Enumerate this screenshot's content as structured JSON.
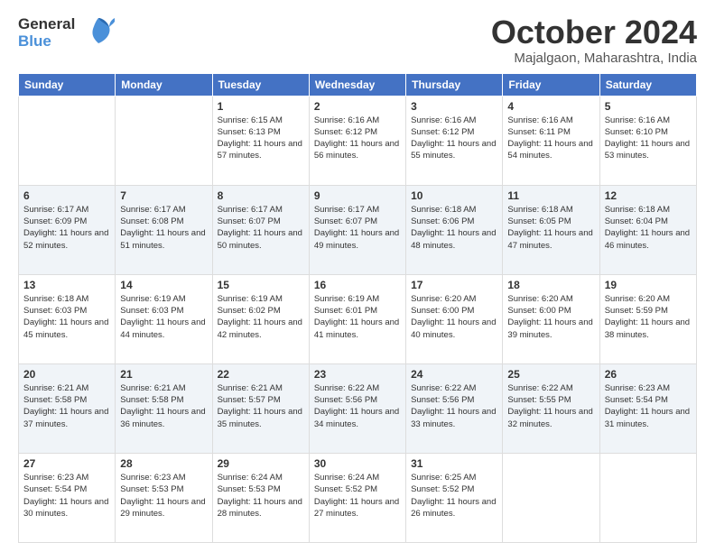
{
  "header": {
    "logo_line1": "General",
    "logo_line2": "Blue",
    "month": "October 2024",
    "location": "Majalgaon, Maharashtra, India"
  },
  "weekdays": [
    "Sunday",
    "Monday",
    "Tuesday",
    "Wednesday",
    "Thursday",
    "Friday",
    "Saturday"
  ],
  "weeks": [
    [
      {
        "day": "",
        "sunrise": "",
        "sunset": "",
        "daylight": ""
      },
      {
        "day": "",
        "sunrise": "",
        "sunset": "",
        "daylight": ""
      },
      {
        "day": "1",
        "sunrise": "Sunrise: 6:15 AM",
        "sunset": "Sunset: 6:13 PM",
        "daylight": "Daylight: 11 hours and 57 minutes."
      },
      {
        "day": "2",
        "sunrise": "Sunrise: 6:16 AM",
        "sunset": "Sunset: 6:12 PM",
        "daylight": "Daylight: 11 hours and 56 minutes."
      },
      {
        "day": "3",
        "sunrise": "Sunrise: 6:16 AM",
        "sunset": "Sunset: 6:12 PM",
        "daylight": "Daylight: 11 hours and 55 minutes."
      },
      {
        "day": "4",
        "sunrise": "Sunrise: 6:16 AM",
        "sunset": "Sunset: 6:11 PM",
        "daylight": "Daylight: 11 hours and 54 minutes."
      },
      {
        "day": "5",
        "sunrise": "Sunrise: 6:16 AM",
        "sunset": "Sunset: 6:10 PM",
        "daylight": "Daylight: 11 hours and 53 minutes."
      }
    ],
    [
      {
        "day": "6",
        "sunrise": "Sunrise: 6:17 AM",
        "sunset": "Sunset: 6:09 PM",
        "daylight": "Daylight: 11 hours and 52 minutes."
      },
      {
        "day": "7",
        "sunrise": "Sunrise: 6:17 AM",
        "sunset": "Sunset: 6:08 PM",
        "daylight": "Daylight: 11 hours and 51 minutes."
      },
      {
        "day": "8",
        "sunrise": "Sunrise: 6:17 AM",
        "sunset": "Sunset: 6:07 PM",
        "daylight": "Daylight: 11 hours and 50 minutes."
      },
      {
        "day": "9",
        "sunrise": "Sunrise: 6:17 AM",
        "sunset": "Sunset: 6:07 PM",
        "daylight": "Daylight: 11 hours and 49 minutes."
      },
      {
        "day": "10",
        "sunrise": "Sunrise: 6:18 AM",
        "sunset": "Sunset: 6:06 PM",
        "daylight": "Daylight: 11 hours and 48 minutes."
      },
      {
        "day": "11",
        "sunrise": "Sunrise: 6:18 AM",
        "sunset": "Sunset: 6:05 PM",
        "daylight": "Daylight: 11 hours and 47 minutes."
      },
      {
        "day": "12",
        "sunrise": "Sunrise: 6:18 AM",
        "sunset": "Sunset: 6:04 PM",
        "daylight": "Daylight: 11 hours and 46 minutes."
      }
    ],
    [
      {
        "day": "13",
        "sunrise": "Sunrise: 6:18 AM",
        "sunset": "Sunset: 6:03 PM",
        "daylight": "Daylight: 11 hours and 45 minutes."
      },
      {
        "day": "14",
        "sunrise": "Sunrise: 6:19 AM",
        "sunset": "Sunset: 6:03 PM",
        "daylight": "Daylight: 11 hours and 44 minutes."
      },
      {
        "day": "15",
        "sunrise": "Sunrise: 6:19 AM",
        "sunset": "Sunset: 6:02 PM",
        "daylight": "Daylight: 11 hours and 42 minutes."
      },
      {
        "day": "16",
        "sunrise": "Sunrise: 6:19 AM",
        "sunset": "Sunset: 6:01 PM",
        "daylight": "Daylight: 11 hours and 41 minutes."
      },
      {
        "day": "17",
        "sunrise": "Sunrise: 6:20 AM",
        "sunset": "Sunset: 6:00 PM",
        "daylight": "Daylight: 11 hours and 40 minutes."
      },
      {
        "day": "18",
        "sunrise": "Sunrise: 6:20 AM",
        "sunset": "Sunset: 6:00 PM",
        "daylight": "Daylight: 11 hours and 39 minutes."
      },
      {
        "day": "19",
        "sunrise": "Sunrise: 6:20 AM",
        "sunset": "Sunset: 5:59 PM",
        "daylight": "Daylight: 11 hours and 38 minutes."
      }
    ],
    [
      {
        "day": "20",
        "sunrise": "Sunrise: 6:21 AM",
        "sunset": "Sunset: 5:58 PM",
        "daylight": "Daylight: 11 hours and 37 minutes."
      },
      {
        "day": "21",
        "sunrise": "Sunrise: 6:21 AM",
        "sunset": "Sunset: 5:58 PM",
        "daylight": "Daylight: 11 hours and 36 minutes."
      },
      {
        "day": "22",
        "sunrise": "Sunrise: 6:21 AM",
        "sunset": "Sunset: 5:57 PM",
        "daylight": "Daylight: 11 hours and 35 minutes."
      },
      {
        "day": "23",
        "sunrise": "Sunrise: 6:22 AM",
        "sunset": "Sunset: 5:56 PM",
        "daylight": "Daylight: 11 hours and 34 minutes."
      },
      {
        "day": "24",
        "sunrise": "Sunrise: 6:22 AM",
        "sunset": "Sunset: 5:56 PM",
        "daylight": "Daylight: 11 hours and 33 minutes."
      },
      {
        "day": "25",
        "sunrise": "Sunrise: 6:22 AM",
        "sunset": "Sunset: 5:55 PM",
        "daylight": "Daylight: 11 hours and 32 minutes."
      },
      {
        "day": "26",
        "sunrise": "Sunrise: 6:23 AM",
        "sunset": "Sunset: 5:54 PM",
        "daylight": "Daylight: 11 hours and 31 minutes."
      }
    ],
    [
      {
        "day": "27",
        "sunrise": "Sunrise: 6:23 AM",
        "sunset": "Sunset: 5:54 PM",
        "daylight": "Daylight: 11 hours and 30 minutes."
      },
      {
        "day": "28",
        "sunrise": "Sunrise: 6:23 AM",
        "sunset": "Sunset: 5:53 PM",
        "daylight": "Daylight: 11 hours and 29 minutes."
      },
      {
        "day": "29",
        "sunrise": "Sunrise: 6:24 AM",
        "sunset": "Sunset: 5:53 PM",
        "daylight": "Daylight: 11 hours and 28 minutes."
      },
      {
        "day": "30",
        "sunrise": "Sunrise: 6:24 AM",
        "sunset": "Sunset: 5:52 PM",
        "daylight": "Daylight: 11 hours and 27 minutes."
      },
      {
        "day": "31",
        "sunrise": "Sunrise: 6:25 AM",
        "sunset": "Sunset: 5:52 PM",
        "daylight": "Daylight: 11 hours and 26 minutes."
      },
      {
        "day": "",
        "sunrise": "",
        "sunset": "",
        "daylight": ""
      },
      {
        "day": "",
        "sunrise": "",
        "sunset": "",
        "daylight": ""
      }
    ]
  ]
}
